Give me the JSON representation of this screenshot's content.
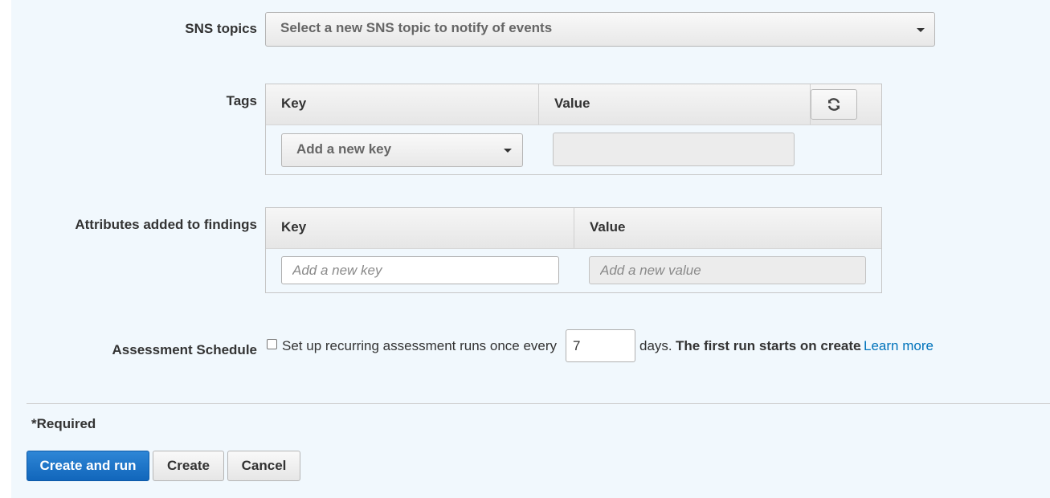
{
  "sns": {
    "label": "SNS topics",
    "placeholder": "Select a new SNS topic to notify of events"
  },
  "tags": {
    "label": "Tags",
    "key_header": "Key",
    "value_header": "Value",
    "key_dropdown": "Add a new key",
    "value_input": ""
  },
  "attributes": {
    "label": "Attributes added to findings",
    "key_header": "Key",
    "value_header": "Value",
    "key_placeholder": "Add a new key",
    "value_placeholder": "Add a new value"
  },
  "schedule": {
    "label": "Assessment Schedule",
    "checked": false,
    "prefix": "Set up recurring assessment runs once every",
    "days_value": "7",
    "suffix": "days.",
    "note": "The first run starts on create",
    "period": ".",
    "learn_more": "Learn more"
  },
  "footer": {
    "required": "*Required",
    "create_and_run": "Create and run",
    "create": "Create",
    "cancel": "Cancel"
  },
  "colors": {
    "page_bg": "#f1f8fd",
    "primary": "#1166bb",
    "link": "#0073bb"
  }
}
